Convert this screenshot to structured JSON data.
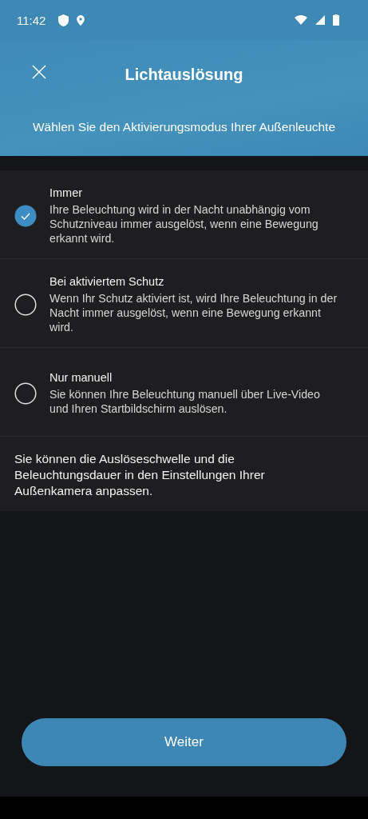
{
  "status_bar": {
    "time": "11:42"
  },
  "header": {
    "title": "Lichtauslösung",
    "subtitle": "Wählen Sie den Aktivierungsmodus Ihrer Außenleuchte"
  },
  "options": [
    {
      "title": "Immer",
      "description": "Ihre Beleuchtung wird in der Nacht unabhängig vom Schutzniveau immer ausgelöst, wenn eine Bewegung erkannt wird.",
      "selected": true
    },
    {
      "title": "Bei aktiviertem Schutz",
      "description": "Wenn Ihr Schutz aktiviert ist, wird Ihre Beleuchtung in der Nacht immer ausgelöst, wenn eine Bewegung erkannt wird.",
      "selected": false
    },
    {
      "title": "Nur manuell",
      "description": "Sie können Ihre Beleuchtung manuell über Live-Video und Ihren Startbildschirm auslösen.",
      "selected": false
    }
  ],
  "note": "Sie können die Auslöseschwelle und die Beleuchtungsdauer in den Einstellungen Ihrer Außenkamera anpassen.",
  "button": "Weiter"
}
